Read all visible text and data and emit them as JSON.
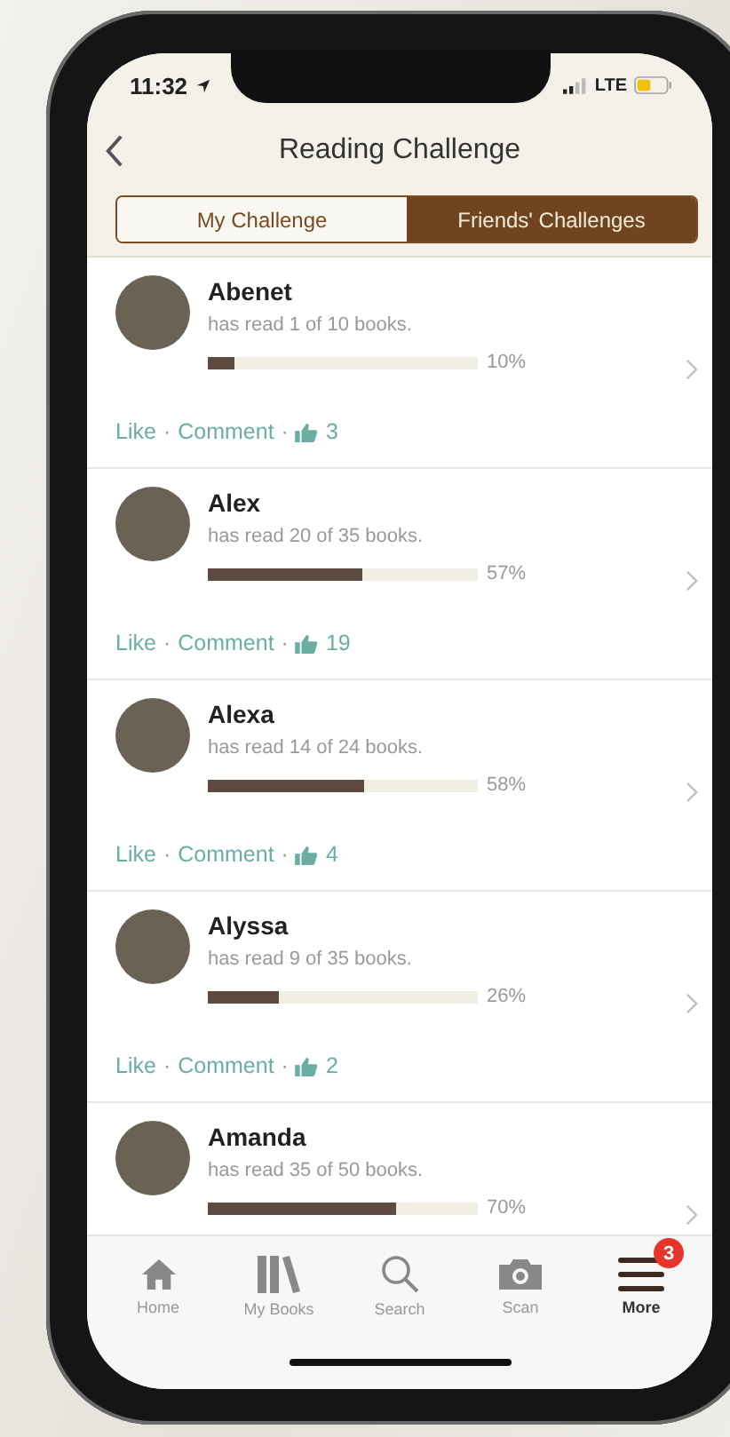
{
  "status_bar": {
    "time": "11:32",
    "network": "LTE"
  },
  "nav": {
    "title": "Reading Challenge"
  },
  "tabs": [
    {
      "label": "My Challenge",
      "selected": false
    },
    {
      "label": "Friends' Challenges",
      "selected": true
    }
  ],
  "friends": [
    {
      "name": "Abenet",
      "progress": "has read 1 of 10 books.",
      "level": 0.1,
      "percent": "10%",
      "like": "Like",
      "separator_1": "·",
      "comment": "Comment",
      "separator_2": "·",
      "likes": "3"
    },
    {
      "name": "Alex",
      "progress": "has read 20 of 35 books.",
      "level": 0.57,
      "percent": "57%",
      "like": "Like",
      "separator_1": "·",
      "comment": "Comment",
      "separator_2": "·",
      "likes": "19"
    },
    {
      "name": "Alexa",
      "progress": "has read 14 of 24 books.",
      "level": 0.58,
      "percent": "58%",
      "like": "Like",
      "separator_1": "·",
      "comment": "Comment",
      "separator_2": "·",
      "likes": "4"
    },
    {
      "name": "Alyssa",
      "progress": "has read 9 of 35 books.",
      "level": 0.26,
      "percent": "26%",
      "like": "Like",
      "separator_1": "·",
      "comment": "Comment",
      "separator_2": "·",
      "likes": "2"
    },
    {
      "name": "Amanda",
      "progress": "has read 35 of 50 books.",
      "level": 0.7,
      "percent": "70%"
    }
  ],
  "tab_bar": [
    {
      "kind": "home",
      "label": "Home",
      "selected": false
    },
    {
      "kind": "books",
      "label": "My Books",
      "selected": false
    },
    {
      "kind": "search",
      "label": "Search",
      "selected": false
    },
    {
      "kind": "camera",
      "label": "Scan",
      "selected": false
    },
    {
      "kind": "menu",
      "label": "More",
      "selected": true,
      "badge": "3"
    }
  ]
}
